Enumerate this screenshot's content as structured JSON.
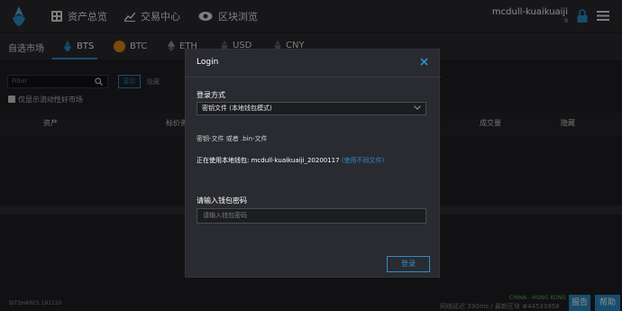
{
  "header": {
    "nav": [
      {
        "label": "资产总览",
        "icon": "grid-icon"
      },
      {
        "label": "交易中心",
        "icon": "chart-icon"
      },
      {
        "label": "区块浏览",
        "icon": "eye-icon"
      }
    ],
    "user": {
      "name": "mcdull-kuaikuaiji",
      "count": "0"
    }
  },
  "market_tabs": {
    "favorites_label": "自选市场",
    "tabs": [
      {
        "label": "BTS",
        "icon": "bts-icon",
        "active": true
      },
      {
        "label": "BTC",
        "icon": "btc-icon",
        "active": false
      },
      {
        "label": "ETH",
        "icon": "eth-icon",
        "active": false
      },
      {
        "label": "USD",
        "icon": "usd-icon",
        "active": false
      },
      {
        "label": "CNY",
        "icon": "cny-icon",
        "active": false
      }
    ]
  },
  "filters": {
    "placeholder": "Filter",
    "show_label": "显示",
    "hide_label": "隐藏",
    "checkbox_label": "仅显示流动性好市场"
  },
  "table": {
    "columns": [
      "资产",
      "标价资",
      "成交量",
      "隐藏"
    ]
  },
  "footer": {
    "version": "BITSHARES 191120",
    "region": "CHINA - HONG KONG",
    "status": "网络延迟 330ms / 最新区块 #44533958",
    "report_label": "报告",
    "help_label": "帮助"
  },
  "modal": {
    "title": "Login",
    "method_label": "登录方式",
    "method_value": "密钥文件 (本地钱包模式)",
    "files_hint": "密钥-文件 或者 .bin-文件",
    "using_wallet_prefix": "正在使用本地钱包: mcdull-kuaikuaiji_20200117",
    "change_wallet_link": "(使用不同文件)",
    "password_label": "请输入钱包密码",
    "password_placeholder": "请输入钱包密码",
    "login_button": "登录"
  },
  "colors": {
    "accent": "#2b8ec9",
    "topbar": "#2a2b30",
    "background": "#191a1f",
    "region_green": "#4bbf4b"
  }
}
